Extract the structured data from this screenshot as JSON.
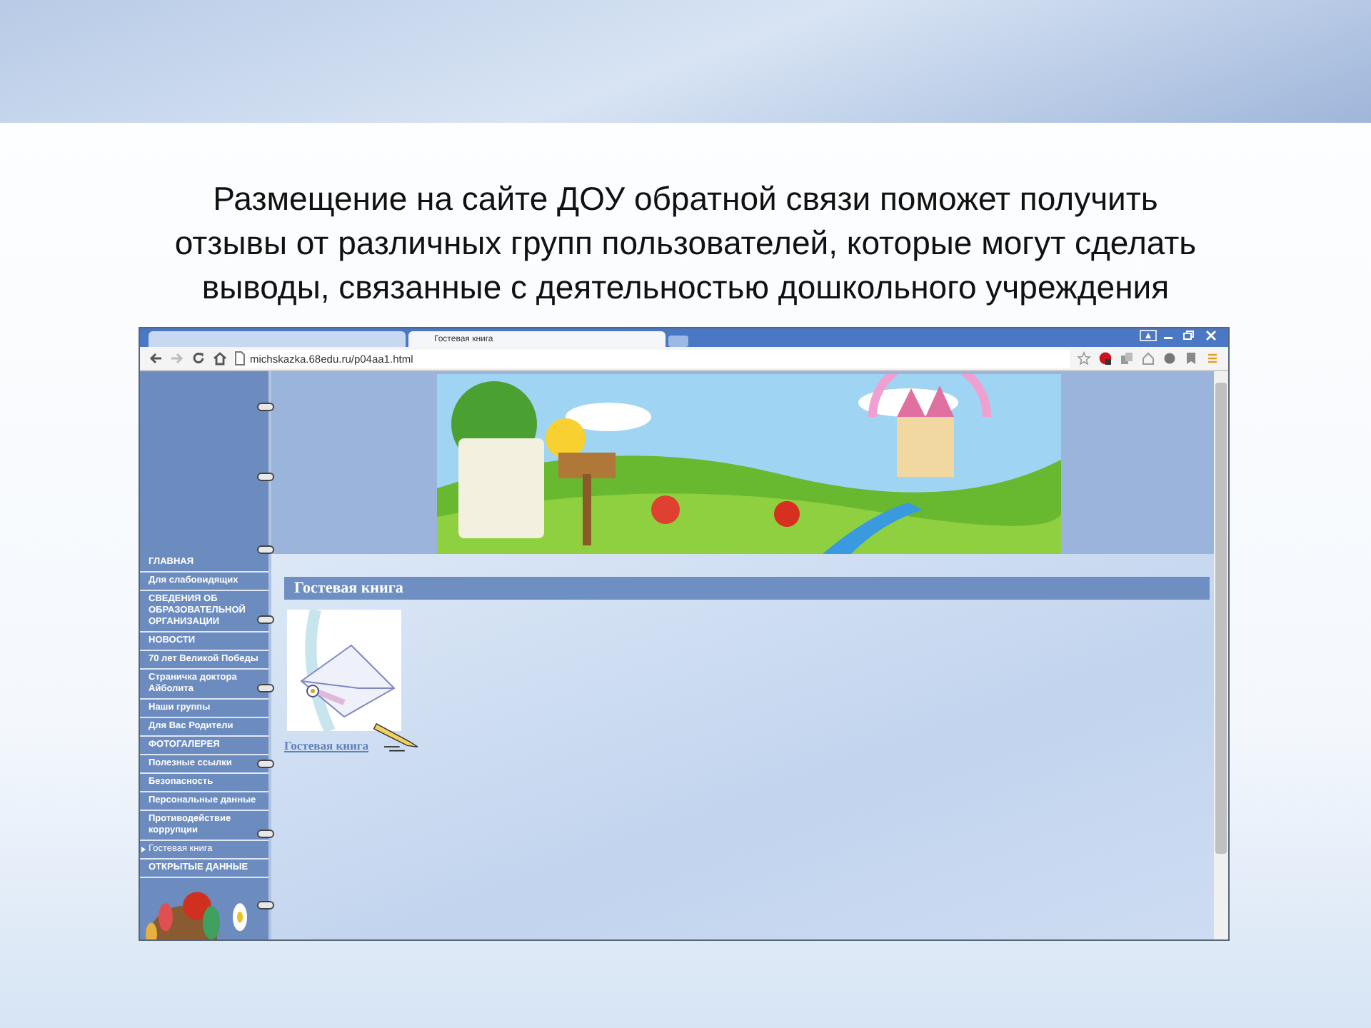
{
  "slide": {
    "title": "Размещение на сайте ДОУ обратной связи поможет получить\nотзывы от различных групп пользователей, которые могут сделать\nвыводы, связанные с деятельностью дошкольного учреждения"
  },
  "browser": {
    "tabs": [
      {
        "selected": false
      },
      {
        "label": "Гостевая книга",
        "selected": true
      }
    ],
    "address": "michskazka.68edu.ru/p04aa1.html"
  },
  "site": {
    "menu": [
      {
        "label": "ГЛАВНАЯ",
        "selected": false
      },
      {
        "label": "Для слабовидящих",
        "selected": false
      },
      {
        "label": "СВЕДЕНИЯ ОБ ОБРАЗОВАТЕЛЬНОЙ ОРГАНИЗАЦИИ",
        "selected": false
      },
      {
        "label": "НОВОСТИ",
        "selected": false
      },
      {
        "label": "70 лет Великой Победы",
        "selected": false
      },
      {
        "label": "Страничка доктора Айболита",
        "selected": false
      },
      {
        "label": "Наши группы",
        "selected": false
      },
      {
        "label": "Для Вас Родители",
        "selected": false
      },
      {
        "label": "ФОТОГАЛЕРЕЯ",
        "selected": false
      },
      {
        "label": "Полезные ссылки",
        "selected": false
      },
      {
        "label": "Безопасность",
        "selected": false
      },
      {
        "label": "Персональные данные",
        "selected": false
      },
      {
        "label": "Противодействие коррупции",
        "selected": false
      },
      {
        "label": "Гостевая книга",
        "selected": true
      },
      {
        "label": "ОТКРЫТЫЕ ДАННЫЕ",
        "selected": false
      }
    ],
    "heading": "Гостевая книга",
    "link": "Гостевая книга"
  }
}
